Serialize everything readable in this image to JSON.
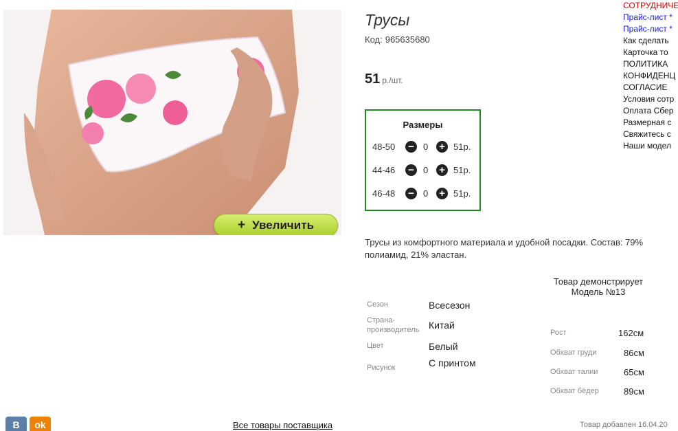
{
  "product": {
    "title": "Трусы",
    "code_label": "Код:",
    "code_value": "965635680",
    "price_value": "51",
    "price_unit": "р./шт.",
    "zoom_label": "Увеличить",
    "zoom_icon": "plus-icon",
    "description": "Трусы из комфортного материала и удобной посадки. Состав: 79% полиамид, 21% эластан."
  },
  "sizes": {
    "title": "Размеры",
    "rows": [
      {
        "size": "48-50",
        "qty": "0",
        "price": "51р."
      },
      {
        "size": "44-46",
        "qty": "0",
        "price": "51р."
      },
      {
        "size": "46-48",
        "qty": "0",
        "price": "51р."
      }
    ]
  },
  "properties": [
    {
      "key": "Сезон",
      "value": "Всесезон"
    },
    {
      "key": "Страна-производитель",
      "value": "Китай"
    },
    {
      "key": "Цвет",
      "value": "Белый"
    },
    {
      "key": "Рисунок",
      "value": "С принтом"
    }
  ],
  "model": {
    "heading": "Товар демонстрирует Модель №13",
    "rows": [
      {
        "key": "Рост",
        "value": "162см"
      },
      {
        "key": "Обхват груди",
        "value": "86см"
      },
      {
        "key": "Обхват талии",
        "value": "65см"
      },
      {
        "key": "Обхват бёдер",
        "value": "89см"
      }
    ]
  },
  "sidebar_links": [
    {
      "label": "СОТРУДНИЧЕ",
      "color": "#d40000"
    },
    {
      "label": "Прайс-лист *",
      "color": "#1a1ad4"
    },
    {
      "label": "Прайс-лист *",
      "color": "#1a1ad4"
    },
    {
      "label": "Как сделать",
      "color": "#111111"
    },
    {
      "label": "Карточка то",
      "color": "#111111"
    },
    {
      "label": "ПОЛИТИКА",
      "color": "#111111"
    },
    {
      "label": "КОНФИДЕНЦ",
      "color": "#111111"
    },
    {
      "label": "СОГЛАСИЕ",
      "color": "#111111"
    },
    {
      "label": "Условия сотр",
      "color": "#111111"
    },
    {
      "label": "Оплата Сбер",
      "color": "#111111"
    },
    {
      "label": "Размерная с",
      "color": "#111111"
    },
    {
      "label": "Свяжитесь с",
      "color": "#111111"
    },
    {
      "label": "Наши модел",
      "color": "#111111"
    }
  ],
  "footer": {
    "vk_label": "В",
    "ok_label": "ok",
    "all_goods_link": "Все товары поставщика",
    "added_text": "Товар добавлен 16.04.20"
  },
  "colors": {
    "sizes_border": "#1f8a1f",
    "zoom_button": "#bfe04a"
  }
}
